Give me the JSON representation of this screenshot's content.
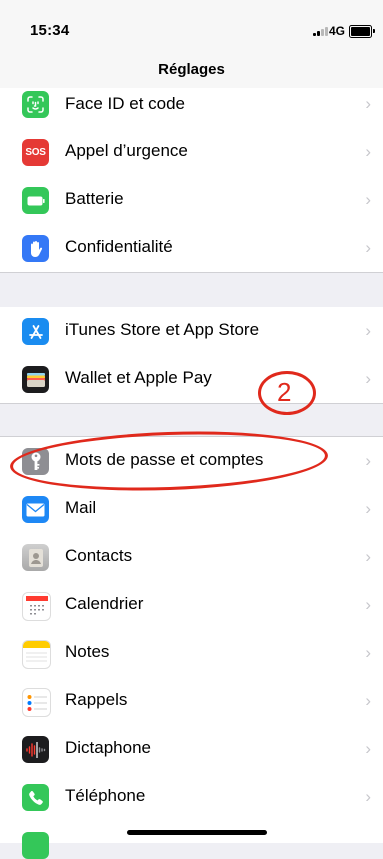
{
  "status_bar": {
    "time": "15:34",
    "network": "4G"
  },
  "nav": {
    "title": "Réglages"
  },
  "rows": [
    {
      "label": "Face ID et code",
      "icon": "face-id-icon",
      "color": "#34c759"
    },
    {
      "label": "Appel d’urgence",
      "icon": "sos-icon",
      "icon_text": "SOS",
      "color": "#e53935"
    },
    {
      "label": "Batterie",
      "icon": "battery-icon",
      "color": "#34c759"
    },
    {
      "label": "Confidentialité",
      "icon": "hand-icon",
      "color": "#3478f6"
    },
    {
      "label": "iTunes Store et App Store",
      "icon": "app-store-icon",
      "color": "#1a8cf0"
    },
    {
      "label": "Wallet et Apple Pay",
      "icon": "wallet-icon",
      "color": "#1c1c1e"
    },
    {
      "label": "Mots de passe et comptes",
      "icon": "key-icon",
      "color": "#8e8e93"
    },
    {
      "label": "Mail",
      "icon": "mail-icon",
      "color": "#1e88f5"
    },
    {
      "label": "Contacts",
      "icon": "contacts-icon",
      "color": "#b9b9b9"
    },
    {
      "label": "Calendrier",
      "icon": "calendar-icon",
      "color": "#ffffff"
    },
    {
      "label": "Notes",
      "icon": "notes-icon",
      "color": "#ffffff"
    },
    {
      "label": "Rappels",
      "icon": "reminders-icon",
      "color": "#ffffff"
    },
    {
      "label": "Dictaphone",
      "icon": "voice-memos-icon",
      "color": "#1c1c1e"
    },
    {
      "label": "Téléphone",
      "icon": "phone-icon",
      "color": "#34c759"
    }
  ],
  "annotation": {
    "step_number": "2",
    "color": "#e0291c"
  },
  "chevron": "›"
}
